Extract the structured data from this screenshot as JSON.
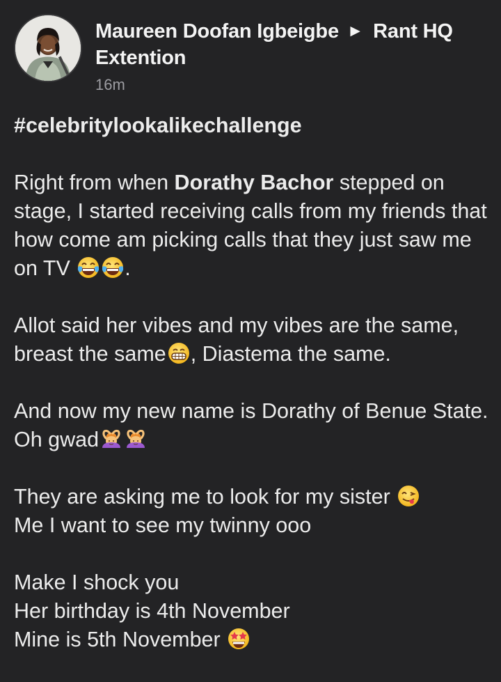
{
  "post": {
    "author": "Maureen Doofan Igbeigbe",
    "arrow": "►",
    "group": "Rant HQ Extention",
    "time": "16m",
    "hashtag": "#celebritylookalikechallenge",
    "p1_a": "Right from when ",
    "p1_mention": "Dorathy Bachor",
    "p1_b": " stepped on stage, I started receiving calls from my friends that how come am picking calls that they just saw me on TV ",
    "p1_end": ".",
    "p2_a": "Allot said her vibes and my vibes are the same, breast the same",
    "p2_b": ", Diastema the same.",
    "p3_a": "And now my new name is Dorathy of Benue State. Oh gwad",
    "p4_a": "They are asking me to look for my sister ",
    "p4_b": "Me I want to see my twinny ooo",
    "p5_a": "Make I shock you",
    "p5_b": "Her birthday is 4th November",
    "p5_c": "Mine is 5th November "
  },
  "icons": {
    "avatar": "profile-photo",
    "emoji_laugh": "face-with-tears-of-joy-icon",
    "emoji_grin": "grinning-face-icon",
    "emoji_ok": "woman-gesturing-ok-icon",
    "emoji_yum": "face-savoring-food-icon",
    "emoji_star": "star-struck-icon"
  },
  "colors": {
    "background": "#232325",
    "text": "#ececec",
    "muted": "#9d9da2",
    "emoji_yellow": "#f7c52a"
  }
}
